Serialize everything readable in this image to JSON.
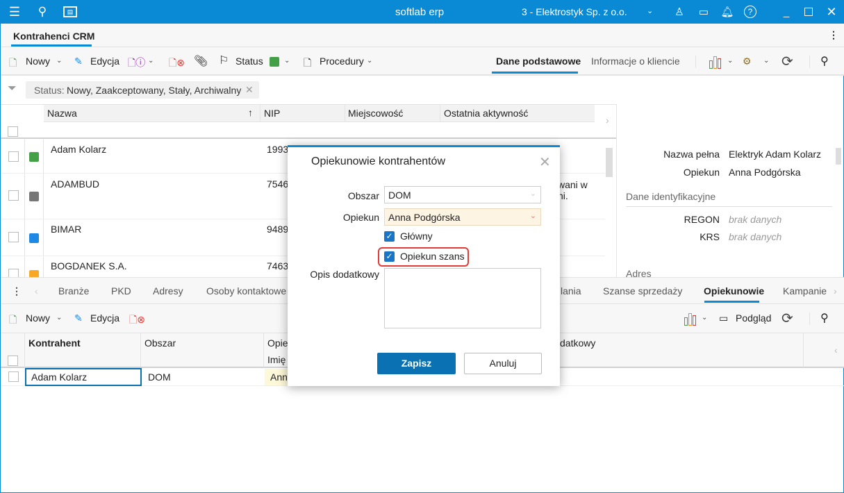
{
  "app": {
    "title": "softlab erp",
    "company": "3 - Elektrostyk Sp. z o.o."
  },
  "tab": {
    "label": "Kontrahenci CRM"
  },
  "toolbar": {
    "new": "Nowy",
    "edit": "Edycja",
    "status": "Status",
    "status_color": "#43a047",
    "procedures": "Procedury",
    "view_tabs": [
      "Dane podstawowe",
      "Informacje o kliencie"
    ]
  },
  "filter": {
    "label": "Status:",
    "value": "Nowy, Zaakceptowany, Stały, Archiwalny"
  },
  "grid": {
    "columns": [
      "Nazwa",
      "NIP",
      "Miejscowość",
      "Ostatnia aktywność"
    ],
    "rows": [
      {
        "name": "Adam Kolarz",
        "nip": "1993",
        "color": "#43a047",
        "extra": ""
      },
      {
        "name": "ADAMBUD",
        "nip": "7546",
        "color": "#777777",
        "extra": "wani w",
        "extra2": "ni."
      },
      {
        "name": "BIMAR",
        "nip": "9489",
        "color": "#1e88e5",
        "extra": ""
      },
      {
        "name": "BOGDANEK S.A.",
        "nip": "7463",
        "color": "#f9a825",
        "extra": ""
      }
    ]
  },
  "details": {
    "full_name_label": "Nazwa pełna",
    "full_name": "Elektryk Adam Kolarz",
    "guardian_label": "Opiekun",
    "guardian": "Anna Podgórska",
    "section_id": "Dane identyfikacyjne",
    "regon_label": "REGON",
    "regon": "brak danych",
    "krs_label": "KRS",
    "krs": "brak danych",
    "section_address": "Adres"
  },
  "bottom_tabs": [
    "Branże",
    "PKD",
    "Adresy",
    "Osoby kontaktowe",
    "lania",
    "Szanse sprzedaży",
    "Opiekunowie",
    "Kampanie"
  ],
  "bottom_toolbar": {
    "new": "Nowy",
    "edit": "Edycja",
    "preview": "Podgląd"
  },
  "bottom_grid": {
    "columns": [
      "Kontrahent",
      "Obszar",
      "Opie",
      "Imię",
      "datkowy"
    ],
    "row": {
      "contractor": "Adam Kolarz",
      "area": "DOM",
      "guardian": "Ann"
    }
  },
  "dialog": {
    "title": "Opiekunowie kontrahentów",
    "area_label": "Obszar",
    "area": "DOM",
    "guardian_label": "Opiekun",
    "guardian": "Anna Podgórska",
    "main_label": "Główny",
    "main_checked": true,
    "opp_label": "Opiekun szans",
    "opp_checked": true,
    "desc_label": "Opis dodatkowy",
    "desc": "",
    "save": "Zapisz",
    "cancel": "Anuluj"
  }
}
